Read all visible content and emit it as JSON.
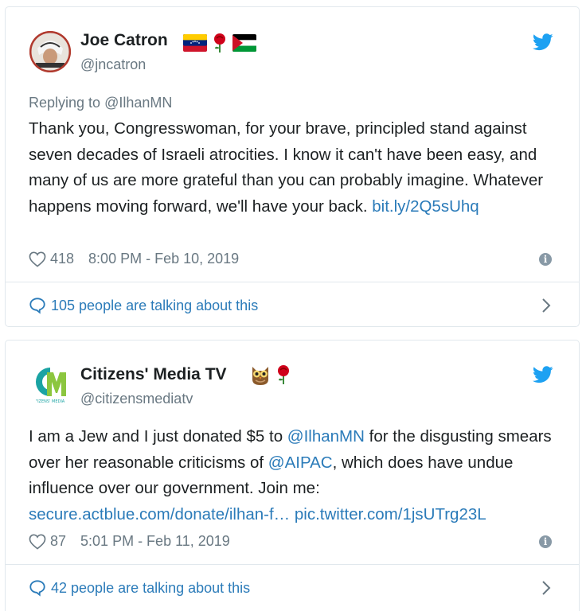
{
  "tweets": [
    {
      "name": "Joe Catron",
      "handle": "@jncatron",
      "emoji_icons": [
        "venezuela-flag-icon",
        "rose-icon",
        "palestine-flag-icon"
      ],
      "replying_prefix": "Replying to ",
      "replying_to": "@IlhanMN",
      "text": "Thank you, Congresswoman, for your brave, principled stand against seven decades of Israeli atrocities. I know it can't have been easy, and many of us are more grateful than you can probably imagine. Whatever happens moving forward, we'll have your back. ",
      "link": "bit.ly/2Q5sUhq",
      "likes": "418",
      "timestamp": "8:00 PM - Feb 10, 2019",
      "talking": "105 people are talking about this"
    },
    {
      "name": "Citizens' Media TV",
      "handle": "@citizensmediatv",
      "emoji_icons": [
        "owl-icon",
        "rose-icon"
      ],
      "text_1": "I am a Jew and I just donated $5 to ",
      "mention_1": "@IlhanMN",
      "text_2": " for the disgusting smears over her reasonable criticisms of ",
      "mention_2": "@AIPAC",
      "text_3": ", which does have undue influence over our government. Join me: ",
      "link_1": "secure.actblue.com/donate/ilhan-f…",
      "link_2": "pic.twitter.com/1jsUTrg23L",
      "likes": "87",
      "timestamp": "5:01 PM - Feb 11, 2019",
      "talking": "42 people are talking about this"
    }
  ],
  "colors": {
    "link": "#2b7bb9",
    "muted": "#697882",
    "text": "#1c2022",
    "twitter_blue": "#1da1f2"
  }
}
